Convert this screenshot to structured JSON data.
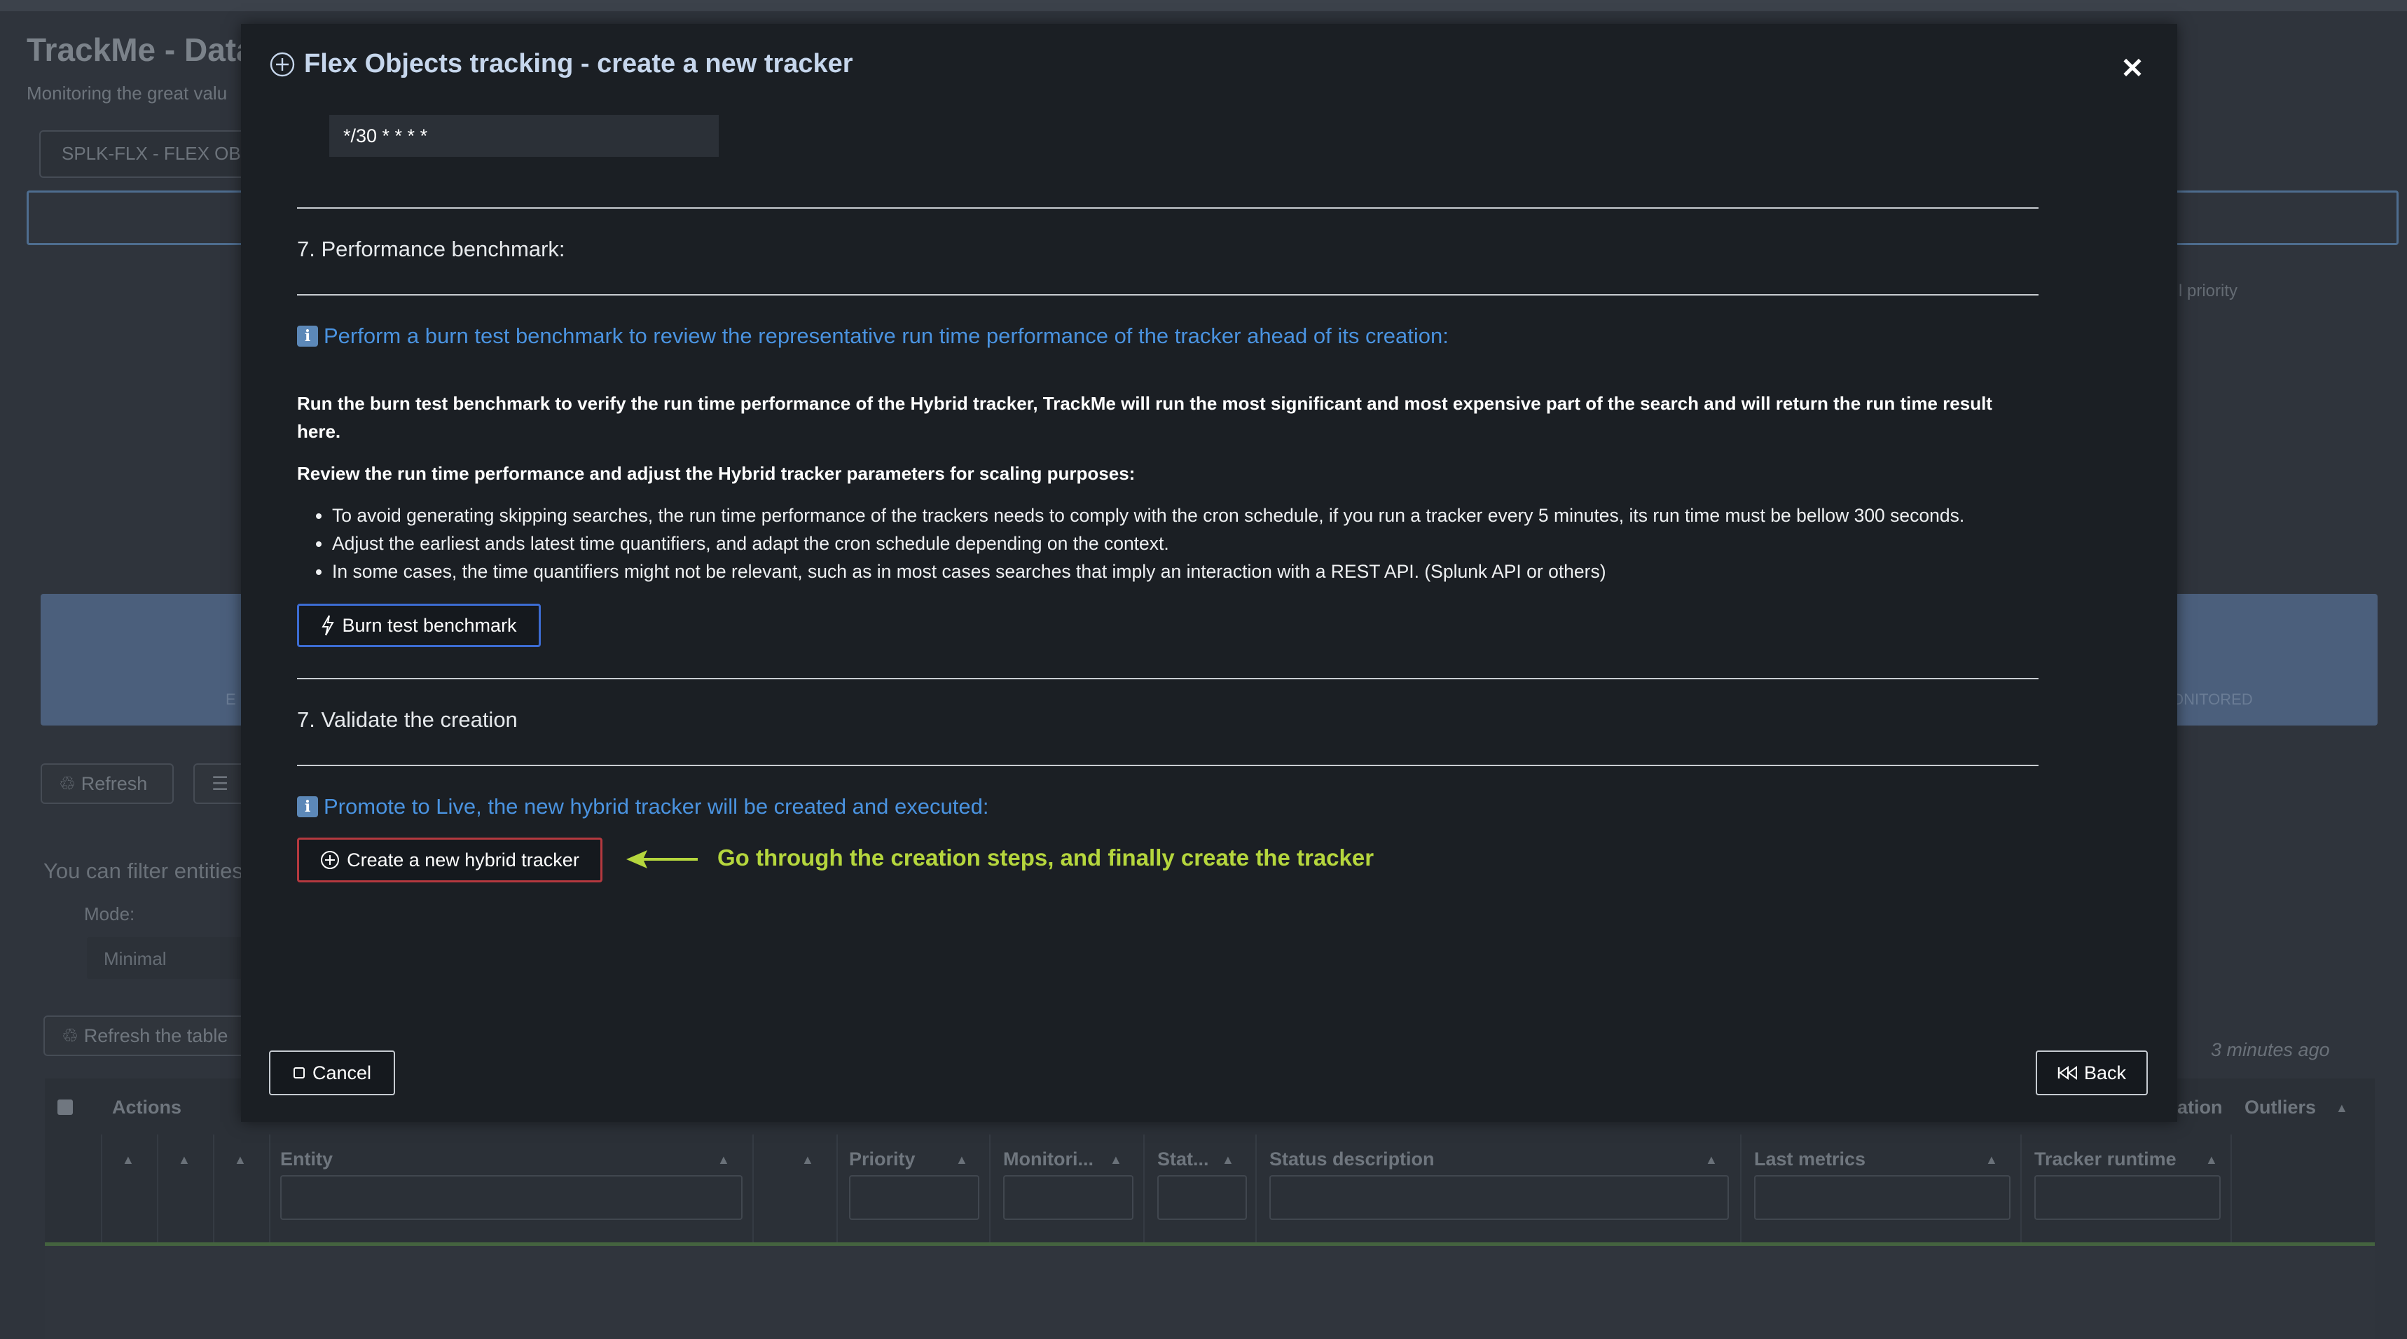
{
  "background": {
    "app_title": "TrackMe - Data",
    "app_subtitle": "Monitoring the great valu",
    "tenant_dropdown": "SPLK-FLX - FLEX OB.",
    "priority_hint": "l priority",
    "panel_left_label": "E",
    "panel_right_label": "ONITORED",
    "refresh_button": "Refresh",
    "filter_text": "You can filter entities",
    "mode_label": "Mode:",
    "mode_value": "Minimal",
    "refresh_table_button": "Refresh the table",
    "last_refresh": "3 minutes ago",
    "table": {
      "headers_top": [
        "Actions",
        "ation",
        "Outliers"
      ],
      "headers": [
        "Entity",
        "Priority",
        "Monitori...",
        "Stat...",
        "Status description",
        "Last metrics",
        "Tracker runtime"
      ]
    }
  },
  "modal": {
    "title": "Flex Objects tracking - create a new tracker",
    "close_icon": "close-icon",
    "cron_value": "*/30 * * * *",
    "section_benchmark": {
      "heading": "7. Performance benchmark:",
      "info": "Perform a burn test benchmark to review the representative run time performance of the tracker ahead of its creation:",
      "paragraph1": "Run the burn test benchmark to verify the run time performance of the Hybrid tracker, TrackMe will run the most significant and most expensive part of the search and will return the run time result here.",
      "paragraph2": "Review the run time performance and adjust the Hybrid tracker parameters for scaling purposes:",
      "bullets": [
        "To avoid generating skipping searches, the run time performance of the trackers needs to comply with the cron schedule, if you run a tracker every 5 minutes, its run time must be bellow 300 seconds.",
        "Adjust the earliest ands latest time quantifiers, and adapt the cron schedule depending on the context.",
        "In some cases, the time quantifiers might not be relevant, such as in most cases searches that imply an interaction with a REST API. (Splunk API or others)"
      ],
      "button": "Burn test benchmark"
    },
    "section_validate": {
      "heading": "7. Validate the creation",
      "info": "Promote to Live, the new hybrid tracker will be created and executed:",
      "button": "Create a new hybrid tracker",
      "annotation": "Go through the creation steps, and finally create the tracker"
    },
    "cancel_button": "Cancel",
    "back_button": "Back"
  },
  "colors": {
    "modal_bg": "#1b1f24",
    "info_blue": "#4a93e0",
    "annotation_green": "#b5d63d",
    "create_border": "#b5393f",
    "burn_border": "#3c6cd3"
  }
}
